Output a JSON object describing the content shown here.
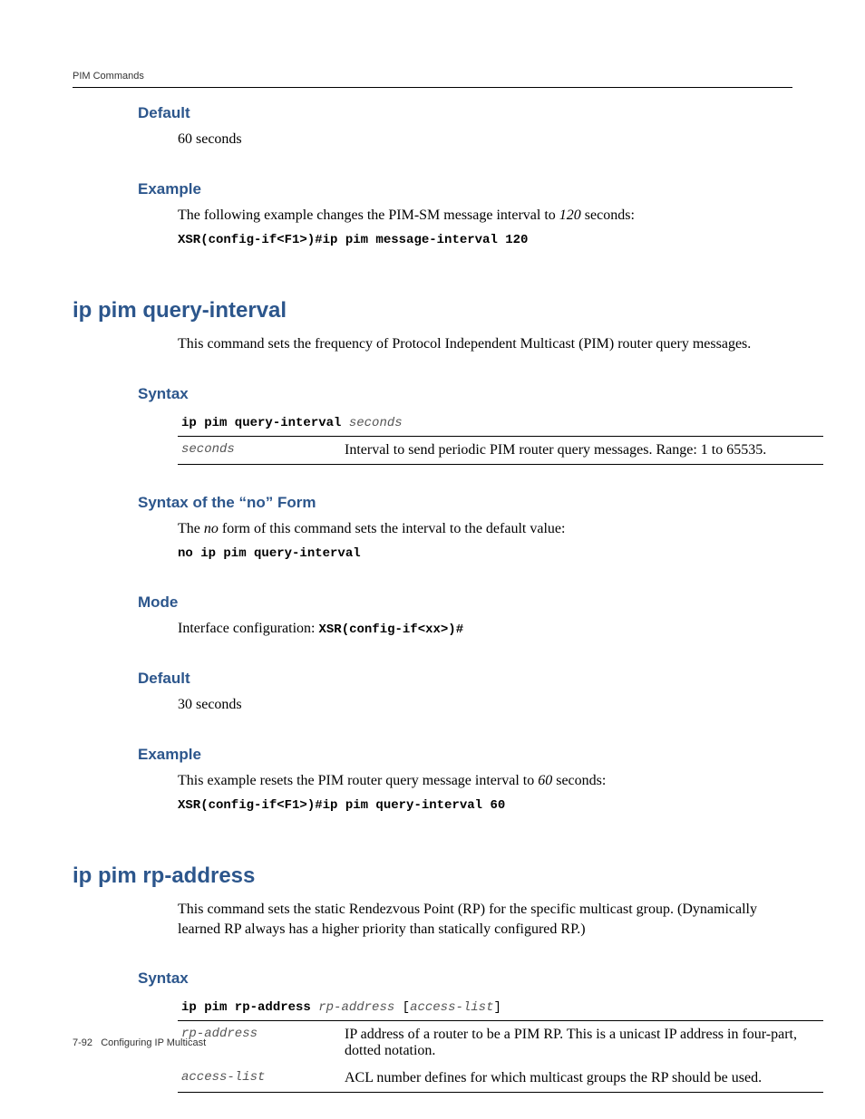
{
  "header": {
    "running": "PIM Commands"
  },
  "sec1": {
    "default_h": "Default",
    "default_v": "60 seconds",
    "example_h": "Example",
    "example_p_a": "The following example changes the PIM-SM message interval to ",
    "example_p_i": "120",
    "example_p_b": " seconds:",
    "example_code": "XSR(config-if<F1>)#ip pim message-interval 120"
  },
  "cmd1": {
    "title": "ip pim query-interval",
    "desc": "This command sets the frequency of Protocol Independent Multicast (PIM) router query messages.",
    "syntax_h": "Syntax",
    "syntax_cmd_b": "ip pim query-interval ",
    "syntax_cmd_i": "seconds",
    "row1_param": "seconds",
    "row1_desc": "Interval to send periodic PIM router query messages. Range: 1 to 65535.",
    "noform_h": "Syntax of the “no” Form",
    "noform_p_a": "The ",
    "noform_p_i": "no",
    "noform_p_b": " form of this command sets the interval to the default value:",
    "noform_code": "no ip pim query-interval",
    "mode_h": "Mode",
    "mode_p_a": "Interface configuration: ",
    "mode_p_code": "XSR(config-if<xx>)#",
    "default_h": "Default",
    "default_v": "30 seconds",
    "example_h": "Example",
    "example_p_a": "This example resets the PIM router query message interval to ",
    "example_p_i": "60",
    "example_p_b": " seconds:",
    "example_code": "XSR(config-if<F1>)#ip pim query-interval 60"
  },
  "cmd2": {
    "title": "ip pim rp-address",
    "desc": "This command sets the static Rendezvous Point (RP) for the specific multicast group. (Dynamically learned RP always has a higher priority than statically configured RP.)",
    "syntax_h": "Syntax",
    "syntax_cmd_b": "ip pim rp-address ",
    "syntax_cmd_i1": "rp-address ",
    "syntax_cmd_lb": "[",
    "syntax_cmd_i2": "access-list",
    "syntax_cmd_rb": "]",
    "row1_param": "rp-address",
    "row1_desc": "IP address of a router to be a PIM RP. This is a unicast IP address in four-part, dotted notation.",
    "row2_param": "access-list",
    "row2_desc": "ACL number defines for which multicast groups the RP should be used."
  },
  "footer": {
    "pg": "7-92",
    "title": "Configuring IP Multicast"
  }
}
